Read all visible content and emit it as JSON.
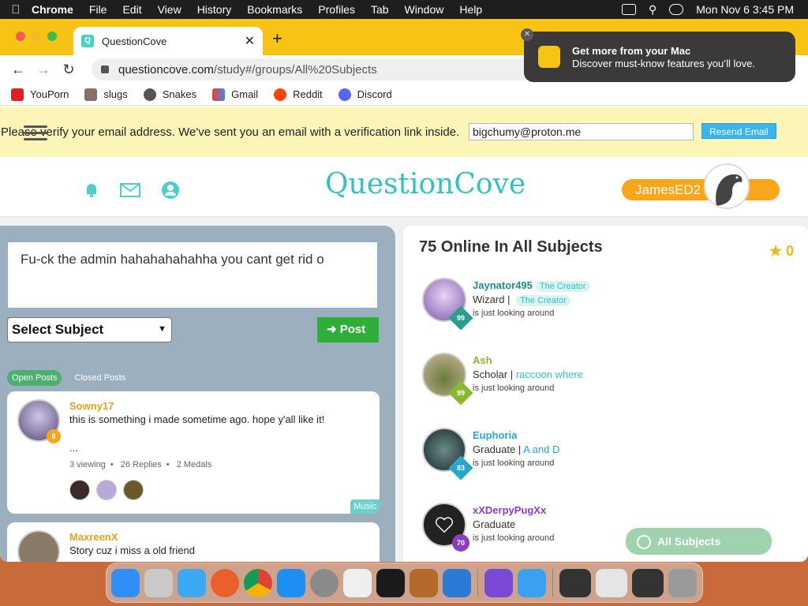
{
  "menubar": {
    "app": "Chrome",
    "items": [
      "File",
      "Edit",
      "View",
      "History",
      "Bookmarks",
      "Profiles",
      "Tab",
      "Window",
      "Help"
    ],
    "clock": "Mon Nov 6  3:45 PM"
  },
  "browser": {
    "tab_title": "QuestionCove",
    "url_host": "questioncove.com",
    "url_path": "/study#/groups/All%20Subjects",
    "bookmarks": [
      "YouPorn",
      "slugs",
      "Snakes",
      "Gmail",
      "Reddit",
      "Discord"
    ]
  },
  "notification": {
    "title": "Get more from your Mac",
    "body": "Discover must-know features you’ll love."
  },
  "verify": {
    "message": "Please verify your email address. We've sent you an email with a verification link inside.",
    "email": "bigchumy@proton.me",
    "resend_label": "Resend Email"
  },
  "header": {
    "logo": "QuestionCove",
    "username": "JamesED2"
  },
  "composer": {
    "text": "Fu-ck the admin hahahahahahha you cant get rid o",
    "subject_select": "Select Subject",
    "post_label": "Post"
  },
  "post_tabs": [
    "Open Posts",
    "Closed Posts"
  ],
  "posts": [
    {
      "author": "Sowny17",
      "level": "8",
      "text": "this is something i made sometime ago. hope y'all like it!",
      "ellipsis": "...",
      "viewing": "3 viewing",
      "replies": "26 Replies",
      "medals": "2 Medals",
      "tag": "Music"
    },
    {
      "author": "MaxreenX",
      "text": "Story cuz i miss a old friend"
    }
  ],
  "online": {
    "title": "75 Online In All Subjects",
    "medal_count": "0",
    "users": [
      {
        "name": "Jaynator495",
        "name_badge": "The Creator",
        "rank": "Wizard",
        "title_badge": "The Creator",
        "status": "is just looking around",
        "level": "99",
        "color": "#1a8c8c",
        "lvl_color": "#2a9d8f"
      },
      {
        "name": "Ash",
        "rank": "Scholar",
        "title": "raccoon where",
        "status": "is just looking around",
        "level": "99",
        "color": "#8ab830",
        "lvl_color": "#8ab830"
      },
      {
        "name": "Euphoria",
        "rank": "Graduate",
        "title": "A and D",
        "status": "is just looking around",
        "level": "83",
        "color": "#2aa6c9",
        "lvl_color": "#2aa6c9"
      },
      {
        "name": "xXDerpyPugXx",
        "rank": "Graduate",
        "status": "is just looking around",
        "level": "70",
        "color": "#8a3fbf",
        "lvl_color": "#8a3fbf"
      }
    ],
    "all_subjects_label": "All Subjects"
  }
}
